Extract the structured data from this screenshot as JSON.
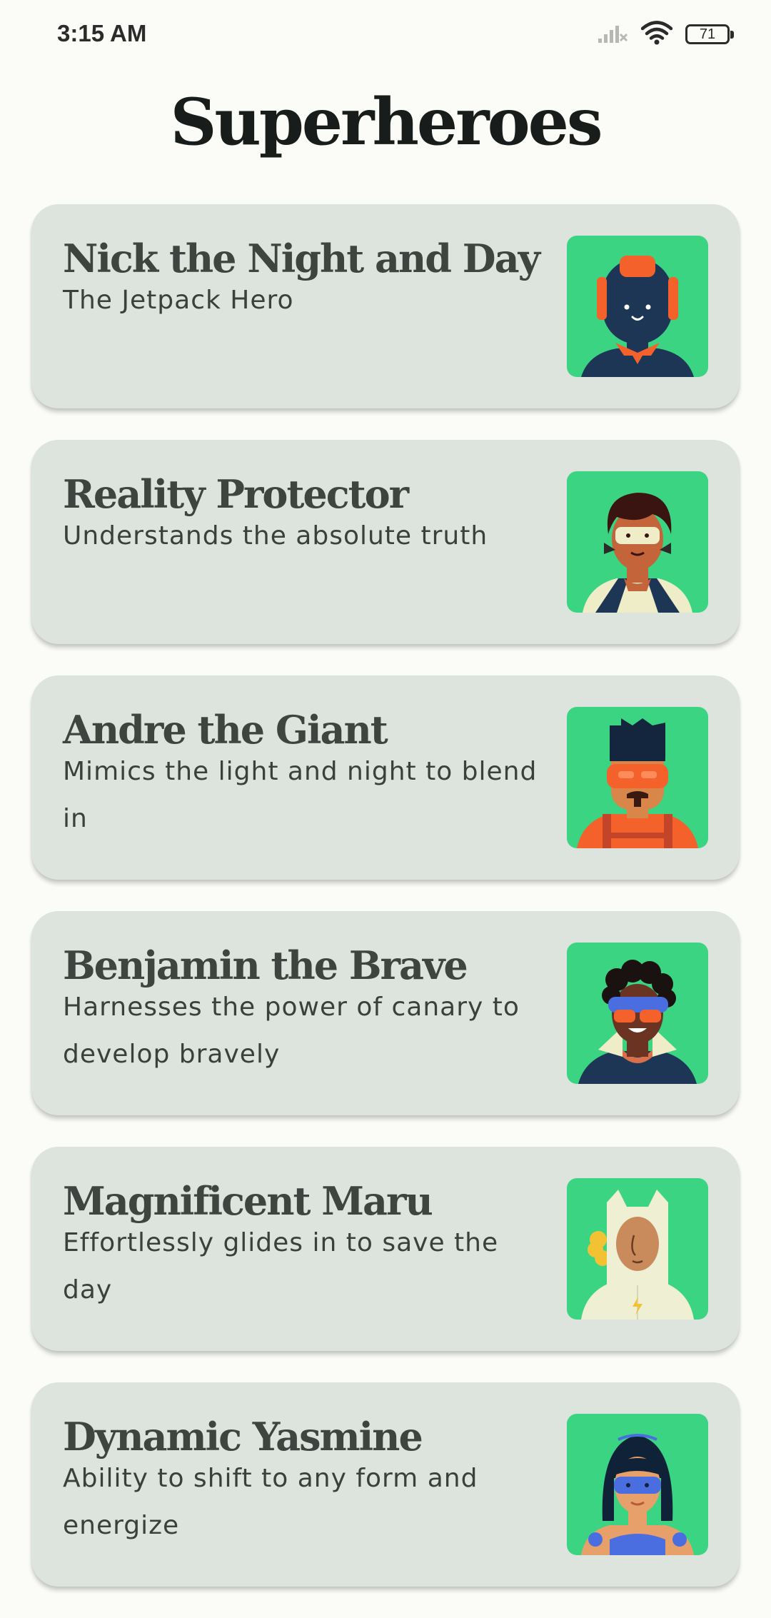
{
  "status_bar": {
    "time": "3:15 AM",
    "battery": "71",
    "icons": [
      "signal-icon",
      "wifi-icon",
      "battery-icon"
    ]
  },
  "title": "Superheroes",
  "colors": {
    "background": "#fbfcf8",
    "card": "#dde4de",
    "avatar_bg": "#3ad483",
    "title": "#181c1a",
    "text": "#3d4540"
  },
  "heroes": [
    {
      "name": "Nick the Night and Day",
      "description": "The Jetpack Hero",
      "avatar_icon": "robot-hero-avatar"
    },
    {
      "name": "Reality Protector",
      "description": "Understands the absolute truth",
      "avatar_icon": "masked-hero-avatar"
    },
    {
      "name": "Andre the Giant",
      "description": "Mimics the light and night to blend in",
      "avatar_icon": "giant-hero-avatar"
    },
    {
      "name": "Benjamin the Brave",
      "description": "Harnesses the power of canary to develop bravely",
      "avatar_icon": "brave-hero-avatar"
    },
    {
      "name": "Magnificent Maru",
      "description": "Effortlessly glides in to save the day",
      "avatar_icon": "maru-hero-avatar"
    },
    {
      "name": "Dynamic Yasmine",
      "description": "Ability to shift to any form and energize",
      "avatar_icon": "yasmine-hero-avatar"
    }
  ]
}
